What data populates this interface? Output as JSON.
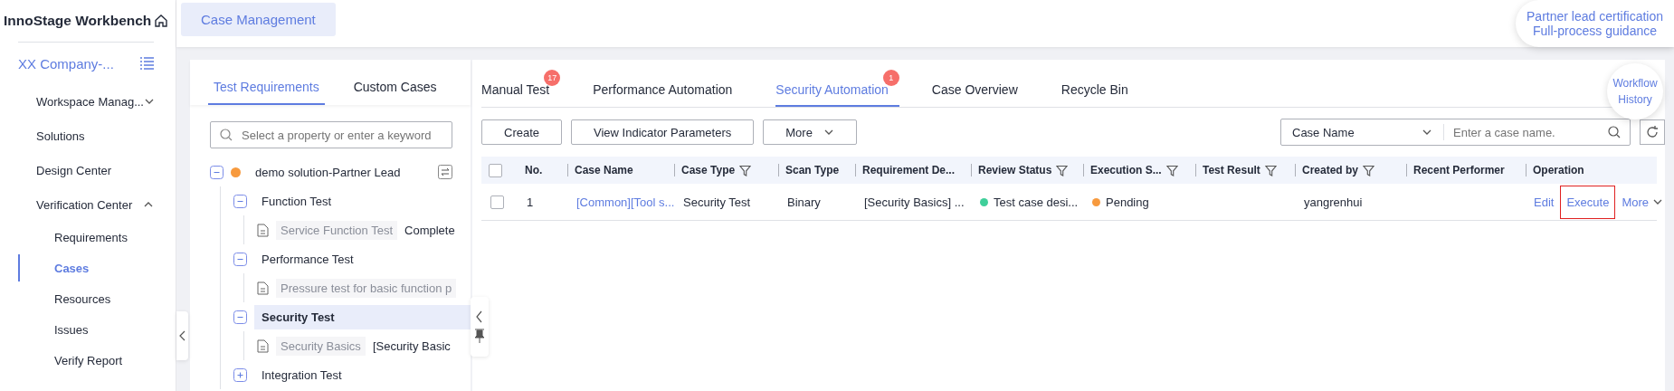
{
  "sidebar": {
    "title": "InnoStage Workbench",
    "workspace": "XX Company-...",
    "items": [
      {
        "label": "Workspace Manag...",
        "kind": "group",
        "expanded": false,
        "selected": false
      },
      {
        "label": "Solutions",
        "kind": "item",
        "selected": false
      },
      {
        "label": "Design Center",
        "kind": "item",
        "selected": false
      },
      {
        "label": "Verification Center",
        "kind": "group",
        "expanded": true,
        "selected": false
      },
      {
        "label": "Requirements",
        "kind": "sub",
        "selected": false
      },
      {
        "label": "Cases",
        "kind": "sub",
        "selected": true
      },
      {
        "label": "Resources",
        "kind": "sub",
        "selected": false
      },
      {
        "label": "Issues",
        "kind": "sub",
        "selected": false
      },
      {
        "label": "Verify Report",
        "kind": "sub",
        "selected": false
      }
    ]
  },
  "header": {
    "tabs": [
      {
        "label": "Case Management",
        "selected": true
      }
    ]
  },
  "guide_bubble": {
    "lines": [
      "Partner lead certification",
      "Full-process guidance"
    ]
  },
  "workflow_bubble": {
    "lines": [
      "Workflow",
      "History"
    ]
  },
  "tree_panel": {
    "tabs": [
      {
        "label": "Test Requirements",
        "selected": true
      },
      {
        "label": "Custom Cases",
        "selected": false
      }
    ],
    "search": {
      "placeholder": "Select a property or enter a keyword"
    },
    "tree": [
      {
        "label": "demo solution-Partner Lead",
        "kind": "root",
        "color": "#f79a3e",
        "expanded": true,
        "selected": false,
        "children": [
          {
            "label": "Function Test",
            "kind": "group",
            "expanded": true,
            "selected": false,
            "children": [
              {
                "label": "Service Function Test",
                "kind": "case",
                "note": "Complete",
                "selected": false
              }
            ]
          },
          {
            "label": "Performance Test",
            "kind": "group",
            "expanded": true,
            "selected": false,
            "children": [
              {
                "label": "Pressure test for basic function p",
                "kind": "case",
                "selected": false
              }
            ]
          },
          {
            "label": "Security Test",
            "kind": "group",
            "expanded": true,
            "selected": true,
            "children": [
              {
                "label": "Security Basics",
                "kind": "case",
                "note": "[Security Basic",
                "selected": false
              }
            ]
          },
          {
            "label": "Integration Test",
            "kind": "group",
            "expanded": false,
            "selected": false
          }
        ]
      }
    ]
  },
  "case_panel": {
    "tabs": [
      {
        "label": "Manual Test",
        "badge": "17",
        "selected": false
      },
      {
        "label": "Performance Automation",
        "selected": false
      },
      {
        "label": "Security Automation",
        "badge": "1",
        "selected": true
      },
      {
        "label": "Case Overview",
        "selected": false
      },
      {
        "label": "Recycle Bin",
        "selected": false
      }
    ],
    "buttons": [
      {
        "label": "Create",
        "kind": "plain"
      },
      {
        "label": "View Indicator Parameters",
        "kind": "plain"
      },
      {
        "label": "More",
        "kind": "dropdown"
      }
    ],
    "filter": {
      "field": "Case Name",
      "placeholder": "Enter a case name."
    },
    "table": {
      "select_all": {
        "checked": false
      },
      "columns": [
        {
          "label": "No.",
          "filter": false
        },
        {
          "label": "Case Name",
          "filter": false
        },
        {
          "label": "Case Type",
          "filter": true
        },
        {
          "label": "Scan Type",
          "filter": false
        },
        {
          "label": "Requirement De...",
          "filter": false
        },
        {
          "label": "Review Status",
          "filter": true
        },
        {
          "label": "Execution S...",
          "filter": true
        },
        {
          "label": "Test Result",
          "filter": true
        },
        {
          "label": "Created by",
          "filter": true
        },
        {
          "label": "Recent Performer",
          "filter": false
        },
        {
          "label": "Operation",
          "filter": false
        }
      ],
      "rows": [
        {
          "checked": false,
          "no": "1",
          "case_name": "[Common][Tool s...",
          "case_type": "Security Test",
          "scan_type": "Binary",
          "requirement": "[Security Basics] ...",
          "review_status": {
            "text": "Test case desi...",
            "color": "#3fcf9a"
          },
          "execution_status": {
            "text": "Pending",
            "color": "#f79a3e"
          },
          "created_by": "yangrenhui",
          "operations": [
            {
              "label": "Edit",
              "highlighted": false,
              "kind": "link"
            },
            {
              "label": "Execute",
              "highlighted": true,
              "kind": "link"
            },
            {
              "label": "More",
              "highlighted": false,
              "kind": "dropdown"
            }
          ]
        }
      ]
    }
  }
}
